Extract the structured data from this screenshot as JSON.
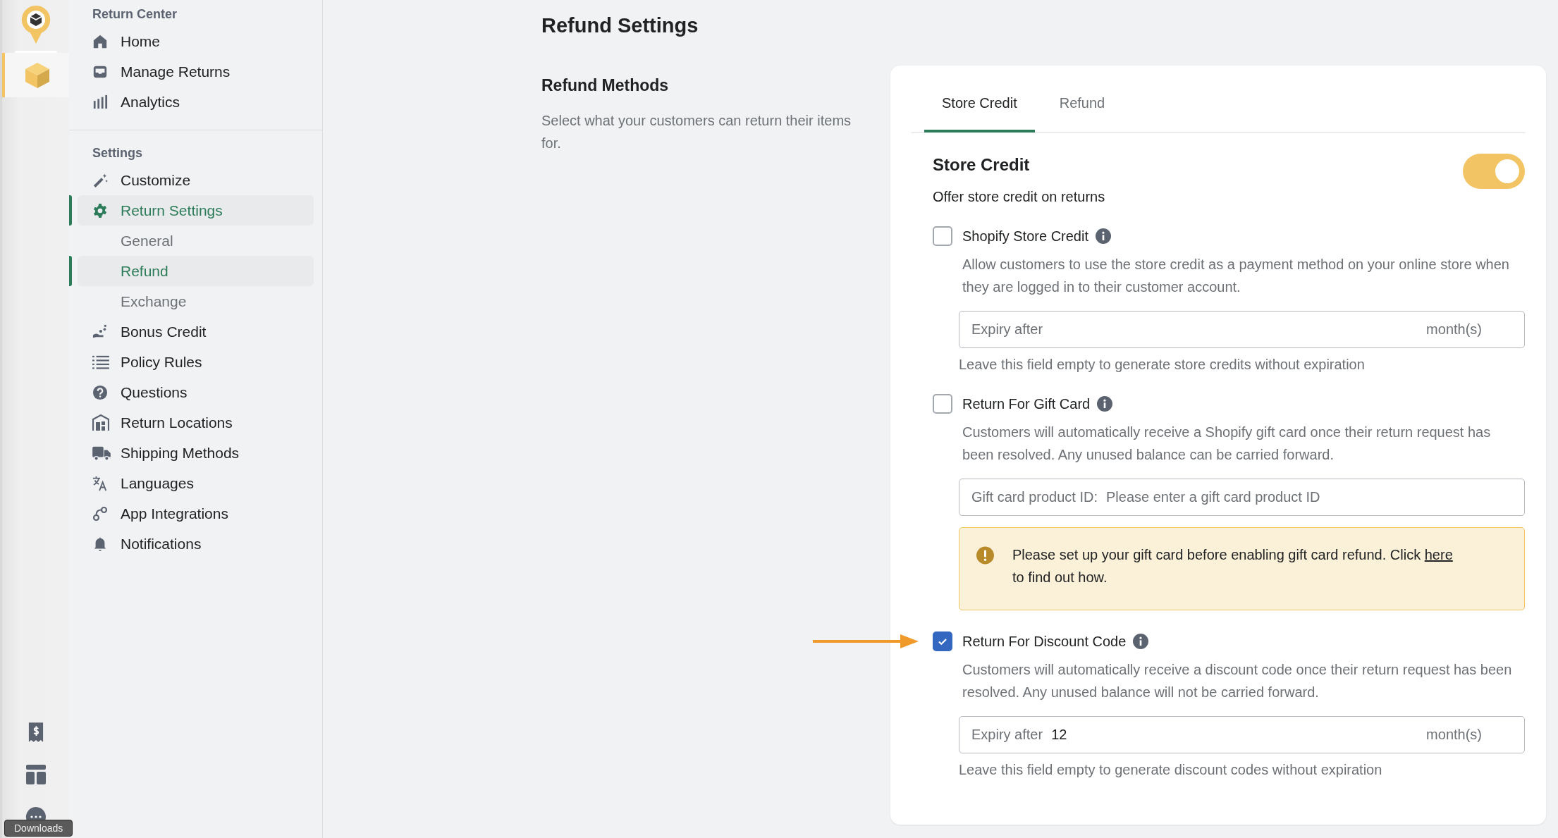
{
  "rail": {
    "apps": [
      {
        "selected": true
      }
    ],
    "tooltip": "Downloads"
  },
  "sidebar": {
    "sections": [
      {
        "heading": "Return Center",
        "items": [
          {
            "label": "Home",
            "selected": false
          },
          {
            "label": "Manage Returns",
            "selected": false
          },
          {
            "label": "Analytics",
            "selected": false
          }
        ]
      },
      {
        "heading": "Settings",
        "items": [
          {
            "label": "Customize",
            "selected": false
          },
          {
            "label": "Return Settings",
            "selected": true,
            "children": [
              {
                "label": "General",
                "selected": false
              },
              {
                "label": "Refund",
                "selected": true
              },
              {
                "label": "Exchange",
                "selected": false
              }
            ]
          },
          {
            "label": "Bonus Credit",
            "selected": false
          },
          {
            "label": "Policy Rules",
            "selected": false
          },
          {
            "label": "Questions",
            "selected": false
          },
          {
            "label": "Return Locations",
            "selected": false
          },
          {
            "label": "Shipping Methods",
            "selected": false
          },
          {
            "label": "Languages",
            "selected": false
          },
          {
            "label": "App Integrations",
            "selected": false
          },
          {
            "label": "Notifications",
            "selected": false
          }
        ]
      }
    ]
  },
  "page": {
    "title": "Refund Settings",
    "section": {
      "heading": "Refund Methods",
      "description": "Select what your customers can return their items for."
    }
  },
  "card": {
    "tabs": [
      {
        "label": "Store Credit",
        "selected": true
      },
      {
        "label": "Refund",
        "selected": false
      }
    ],
    "panel": {
      "title": "Store Credit",
      "subtitle": "Offer store credit on returns",
      "on": true
    },
    "options": [
      {
        "label": "Shopify Store Credit",
        "checked": false,
        "description": "Allow customers to use the store credit as a payment method on your online store when they are logged in to their customer account.",
        "field": {
          "label": "Expiry after",
          "suffix": "month(s)"
        },
        "hint": "Leave this field empty to generate store credits without expiration"
      },
      {
        "label": "Return For Gift Card",
        "checked": false,
        "description": "Customers will automatically receive a Shopify gift card once their return request has been resolved. Any unused balance can be carried forward.",
        "field": {
          "label": "Gift card product ID:",
          "placeholder": "Please enter a gift card product ID"
        },
        "alert": {
          "text": "Please set up your gift card before enabling gift card refund. Click",
          "link": "here",
          "text_after": "to find out how."
        }
      },
      {
        "label": "Return For Discount Code",
        "checked": true,
        "annotated": true,
        "description": "Customers will automatically receive a discount code once their return request has been resolved. Any unused balance will not be carried forward.",
        "field": {
          "label": "Expiry after",
          "value": "12",
          "suffix": "month(s)"
        },
        "hint": "Leave this field empty to generate discount codes without expiration"
      }
    ]
  }
}
